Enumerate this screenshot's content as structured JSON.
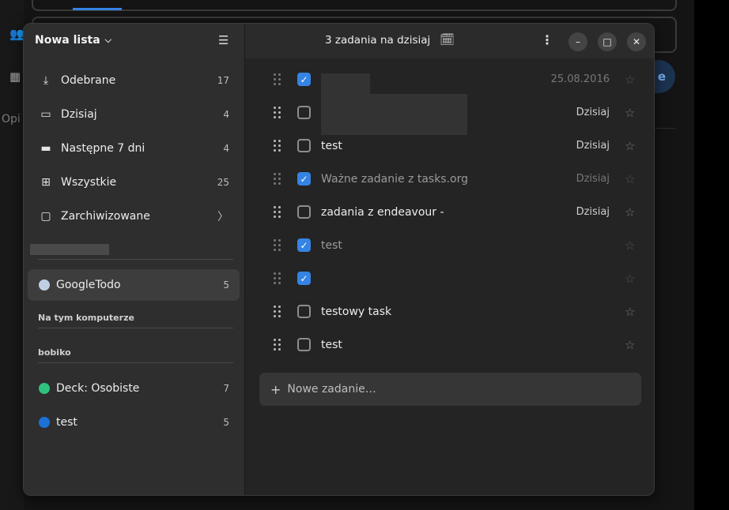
{
  "background": {
    "side_label": "Opi",
    "partial_button_label": "e"
  },
  "sidebar": {
    "title": "Nowa lista",
    "smart_lists": [
      {
        "label": "Odebrane",
        "count": "17",
        "icon": "inbox-icon"
      },
      {
        "label": "Dzisiaj",
        "count": "4",
        "icon": "calendar-today-icon"
      },
      {
        "label": "Następne 7 dni",
        "count": "4",
        "icon": "calendar-week-icon"
      },
      {
        "label": "Wszystkie",
        "count": "25",
        "icon": "grid-icon"
      },
      {
        "label": "Zarchiwizowane",
        "icon": "folder-icon"
      }
    ],
    "google_list": {
      "label": "GoogleTodo",
      "count": "5",
      "color": "#c0cfe3"
    },
    "section_local": "Na tym komputerze",
    "section_account": "bobiko",
    "account_lists": [
      {
        "label": "Deck: Osobiste",
        "count": "7",
        "color": "#2ec27e"
      },
      {
        "label": "test",
        "count": "5",
        "color": "#1c71d8"
      }
    ]
  },
  "main": {
    "title": "3 zadania na dzisiaj",
    "tasks": [
      {
        "title": "",
        "date": "25.08.2016",
        "done": true
      },
      {
        "title": "",
        "date": "Dzisiaj",
        "done": false
      },
      {
        "title": "test",
        "date": "Dzisiaj",
        "done": false
      },
      {
        "title": "Ważne zadanie z tasks.org",
        "date": "Dzisiaj",
        "done": true
      },
      {
        "title": "zadania z endeavour -",
        "date": "Dzisiaj",
        "done": false
      },
      {
        "title": "test",
        "date": "",
        "done": true
      },
      {
        "title": "",
        "date": "",
        "done": true
      },
      {
        "title": "testowy task",
        "date": "",
        "done": false
      },
      {
        "title": "test",
        "date": "",
        "done": false
      }
    ],
    "new_task_placeholder": "Nowe zadanie…"
  },
  "colors": {
    "accent": "#3584e4"
  }
}
